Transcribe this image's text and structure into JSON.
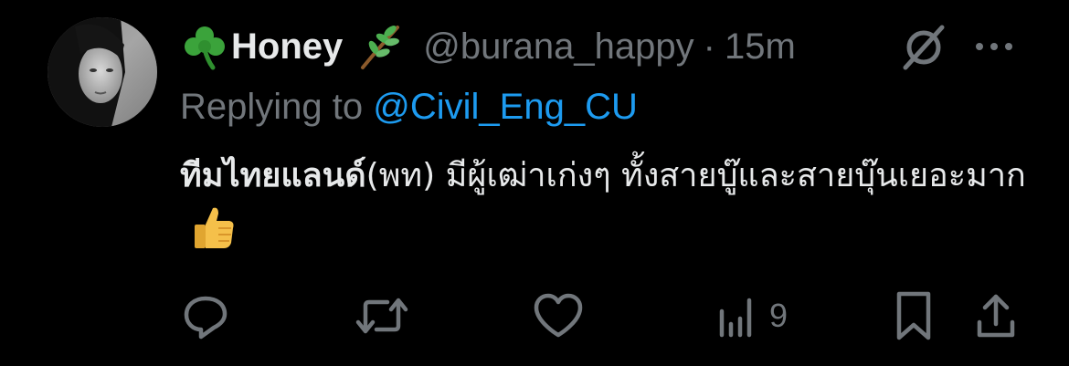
{
  "tweet": {
    "display_name": "Honey",
    "name_emoji_left": "shamrock-emoji",
    "name_emoji_right": "herb-emoji",
    "handle": "@burana_happy",
    "separator": "·",
    "time": "15m",
    "replying_prefix": "Replying to",
    "replying_to": "@Civil_Eng_CU",
    "text_bold": "ทีมไทยแลนด์",
    "text_rest": "(พท) มีผู้เฒ่าเก่งๆ ทั้งสายบู๊และสายบุ๊นเยอะมาก",
    "text_emoji": "thumbs-up-emoji"
  },
  "actions": {
    "reply_icon": "reply-icon",
    "retweet_icon": "retweet-icon",
    "like_icon": "like-icon",
    "views_icon": "views-icon",
    "views_count": "9",
    "bookmark_icon": "bookmark-icon",
    "share_icon": "share-icon"
  },
  "colors": {
    "background": "#000000",
    "primary_text": "#e7e9ea",
    "secondary_text": "#71767b",
    "link": "#1d9bf0"
  }
}
